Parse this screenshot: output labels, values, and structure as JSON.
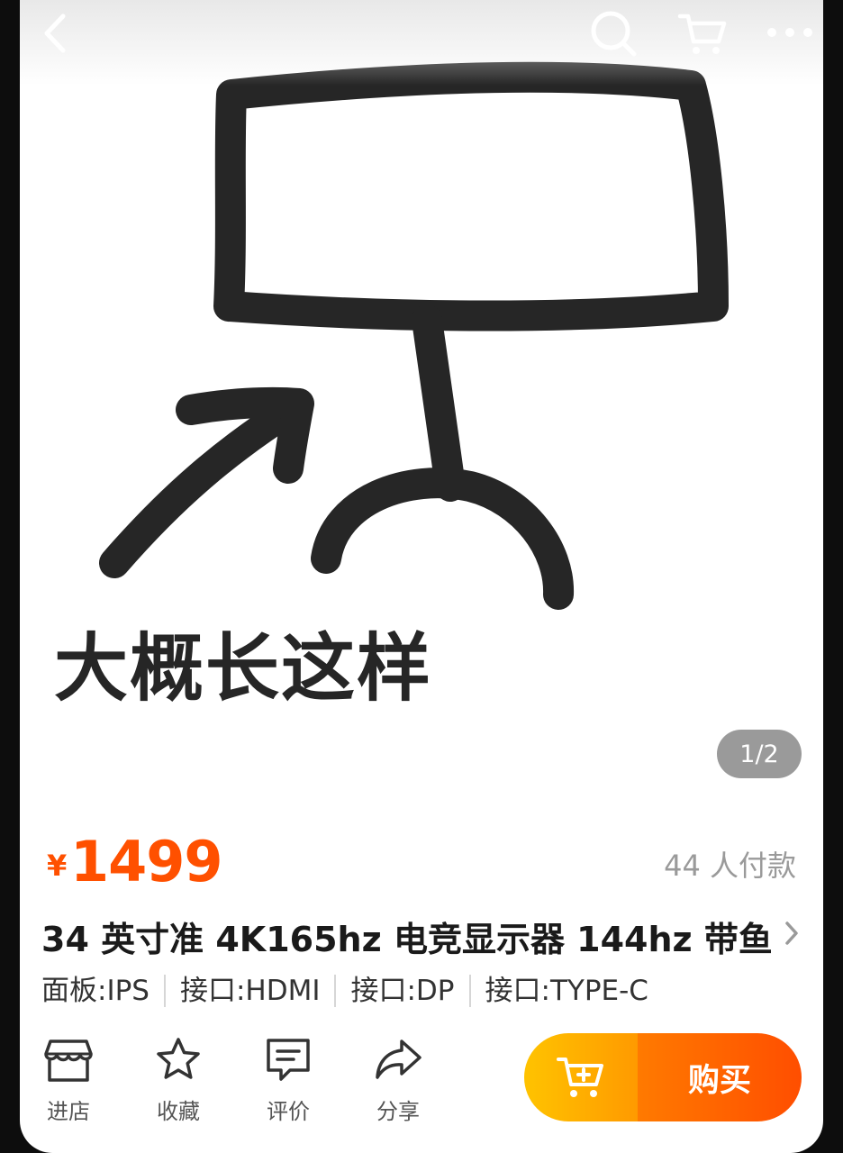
{
  "header": {
    "back_icon": "chevron-left-icon",
    "search_icon": "search-icon",
    "cart_icon": "cart-icon",
    "more_icon": "more-dots-icon"
  },
  "gallery": {
    "caption": "大概长这样",
    "pager": "1/2"
  },
  "product": {
    "currency": "¥",
    "price": "1499",
    "sold": "44 人付款",
    "title": "34 英寸准 4K165hz 电竞显示器 144hz 带鱼",
    "specs": [
      "面板:IPS",
      "接口:HDMI",
      "接口:DP",
      "接口:TYPE-C"
    ]
  },
  "bottom_bar": {
    "actions": [
      {
        "label": "进店",
        "icon": "store-icon"
      },
      {
        "label": "收藏",
        "icon": "star-icon"
      },
      {
        "label": "评价",
        "icon": "comment-icon"
      },
      {
        "label": "分享",
        "icon": "share-icon"
      }
    ],
    "cart_icon": "add-to-cart-icon",
    "buy_label": "购买"
  },
  "colors": {
    "accent": "#ff5000",
    "buy_gradient_start": "#ffc300",
    "buy_gradient_end": "#ff4e00"
  }
}
